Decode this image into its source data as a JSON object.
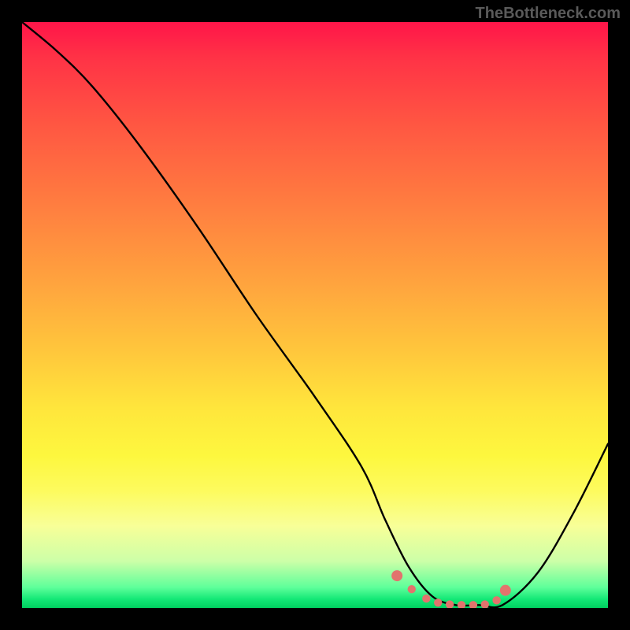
{
  "watermark": "TheBottleneck.com",
  "chart_data": {
    "type": "line",
    "title": "",
    "xlabel": "",
    "ylabel": "",
    "xlim": [
      0,
      100
    ],
    "ylim": [
      0,
      100
    ],
    "series": [
      {
        "name": "bottleneck-curve",
        "x": [
          0,
          6,
          12,
          20,
          30,
          40,
          50,
          58,
          62,
          66,
          70,
          74,
          78,
          82,
          88,
          94,
          100
        ],
        "y": [
          100,
          95,
          89,
          79,
          65,
          50,
          36,
          24,
          15,
          7,
          2,
          0.5,
          0.5,
          0.5,
          6,
          16,
          28
        ]
      }
    ],
    "markers": {
      "name": "optimal-range-dots",
      "x": [
        64,
        66.5,
        69,
        71,
        73,
        75,
        77,
        79,
        81,
        82.5
      ],
      "y": [
        5.5,
        3.2,
        1.6,
        0.9,
        0.6,
        0.5,
        0.5,
        0.6,
        1.3,
        3.0
      ]
    },
    "gradient_stops": [
      {
        "pos": 0.0,
        "color": "#ff1549"
      },
      {
        "pos": 0.18,
        "color": "#ff5842"
      },
      {
        "pos": 0.44,
        "color": "#ffa23e"
      },
      {
        "pos": 0.66,
        "color": "#ffe63c"
      },
      {
        "pos": 0.86,
        "color": "#f8ff98"
      },
      {
        "pos": 0.96,
        "color": "#5eff9a"
      },
      {
        "pos": 1.0,
        "color": "#00d060"
      }
    ]
  }
}
